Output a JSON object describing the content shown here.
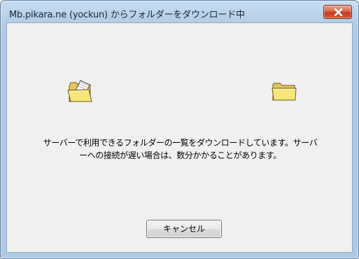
{
  "window": {
    "title": "Mb.pikara.ne (yockun) からフォルダーをダウンロード中"
  },
  "message": {
    "line1": "サーバーで利用できるフォルダーの一覧をダウンロードしています。サーバ",
    "line2": "ーへの接続が遅い場合は、数分かかることがあります。"
  },
  "buttons": {
    "cancel": "キャンセル"
  },
  "icons": {
    "close": "close-icon",
    "source": "open-folder-with-document-icon",
    "destination": "folder-icon"
  },
  "colors": {
    "title_bar": "#b9d1ea",
    "close_button": "#c53c22",
    "dialog_background": "#f0f0f0",
    "folder_yellow": "#f4e27a"
  }
}
